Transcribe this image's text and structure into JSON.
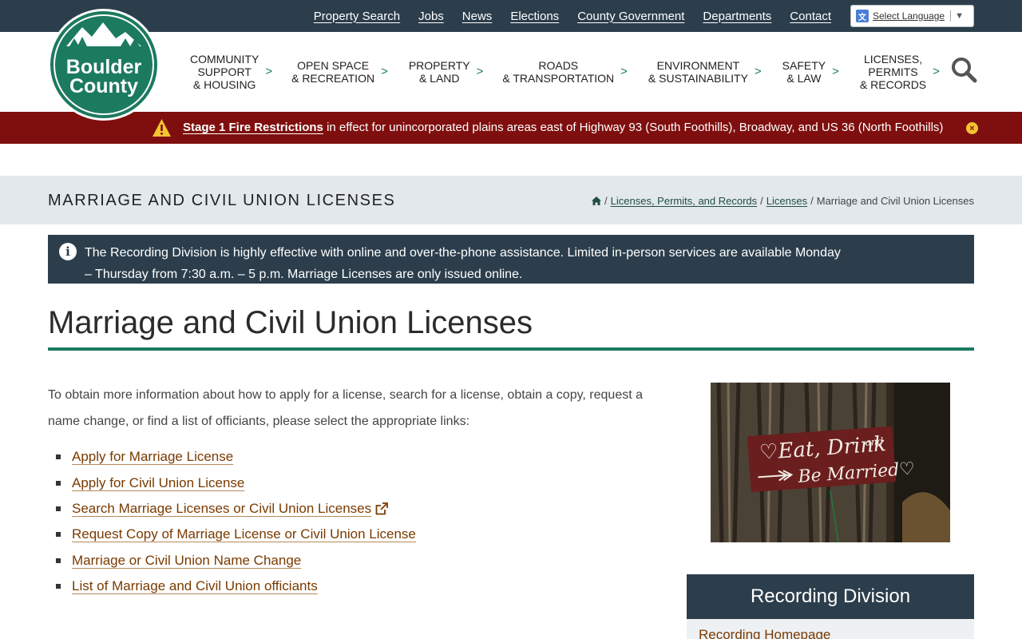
{
  "utility_nav": {
    "links": [
      "Property Search",
      "Jobs",
      "News",
      "Elections",
      "County Government",
      "Departments",
      "Contact"
    ],
    "language_label": "Select Language"
  },
  "logo": {
    "line1": "Boulder",
    "line2": "County"
  },
  "main_nav": [
    {
      "label": "Community\nSupport\n& Housing"
    },
    {
      "label": "Open Space\n& Recreation"
    },
    {
      "label": "Property\n& Land"
    },
    {
      "label": "Roads\n& Transportation"
    },
    {
      "label": "Environment\n& Sustainability"
    },
    {
      "label": "Safety\n& Law"
    },
    {
      "label": "Licenses,\nPermits\n& Records"
    }
  ],
  "alert": {
    "strong": "Stage 1 Fire Restrictions",
    "text": " in effect for unincorporated plains areas east of Highway 93 (South Foothills), Broadway, and US 36 (North Foothills)",
    "close": "×"
  },
  "page_title": "Marriage and Civil Union Licenses",
  "breadcrumb": {
    "items": [
      "Licenses, Permits, and Records",
      "Licenses"
    ],
    "current": "Marriage and Civil Union Licenses",
    "separator": "/"
  },
  "notice": {
    "text": "The Recording Division is highly effective with online and over-the-phone assistance. Limited in-person services are available Monday – Thursday from 7:30 a.m. – 5 p.m. Marriage Licenses are only issued online."
  },
  "heading": "Marriage and Civil Union Licenses",
  "intro": "To obtain more information about how to apply for a license, search for a license, obtain a copy, request a name change, or find a list of officiants, please select the appropriate links:",
  "links": [
    {
      "label": "Apply for Marriage License",
      "external": false
    },
    {
      "label": "Apply for Civil Union License",
      "external": false
    },
    {
      "label": "Search Marriage Licenses or Civil Union Licenses",
      "external": true
    },
    {
      "label": "Request Copy of Marriage License or Civil Union License",
      "external": false
    },
    {
      "label": "Marriage or Civil Union Name Change",
      "external": false
    },
    {
      "label": "List of Marriage and Civil Union officiants",
      "external": false
    }
  ],
  "sign": {
    "line1": "♡Eat, Drink",
    "and": "and",
    "line2": "Be Married♡"
  },
  "sidebar": {
    "title": "Recording Division",
    "first_link": "Recording Homepage"
  },
  "colors": {
    "header_dark": "#2c3e4c",
    "brand_green": "#1c7a5f",
    "alert_red": "#7f0f0f",
    "link_brown": "#7a3a00"
  }
}
